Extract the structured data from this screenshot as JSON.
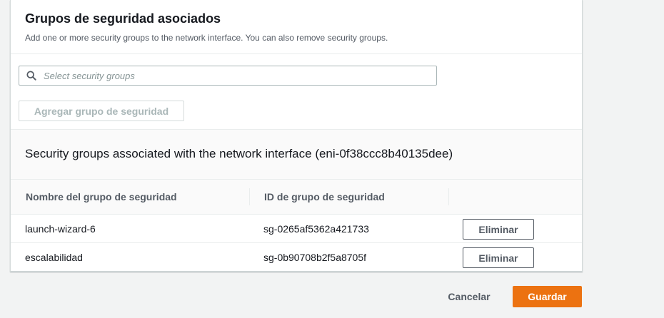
{
  "section": {
    "title": "Grupos de seguridad asociados",
    "description": "Add one or more security groups to the network interface. You can also remove security groups."
  },
  "search": {
    "placeholder": "Select security groups",
    "value": "",
    "icon": "search-icon"
  },
  "add_button_label": "Agregar grupo de seguridad",
  "associated": {
    "title": "Security groups associated with the network interface (eni-0f38ccc8b40135dee)",
    "columns": [
      "Nombre del grupo de seguridad",
      "ID de grupo de seguridad"
    ],
    "rows": [
      {
        "name": "launch-wizard-6",
        "id": "sg-0265af5362a421733",
        "action": "Eliminar"
      },
      {
        "name": "escalabilidad",
        "id": "sg-0b90708b2f5a8705f",
        "action": "Eliminar"
      }
    ]
  },
  "footer": {
    "cancel_label": "Cancelar",
    "save_label": "Guardar"
  },
  "colors": {
    "primary": "#ec7211",
    "text": "#16191f",
    "muted": "#545b64",
    "disabled": "#aab7b8",
    "background": "#f2f3f3"
  }
}
